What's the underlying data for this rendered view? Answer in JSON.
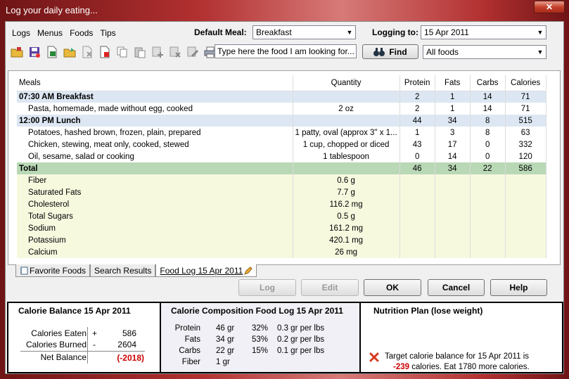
{
  "window": {
    "title": "Log your daily eating...",
    "close_label": "✕"
  },
  "menu": [
    "Logs",
    "Menus",
    "Foods",
    "Tips"
  ],
  "header": {
    "default_meal_label": "Default Meal:",
    "default_meal_value": "Breakfast",
    "logging_to_label": "Logging to:",
    "logging_to_value": "15 Apr 2011"
  },
  "toolbar": {
    "icons": [
      "open-folder-icon",
      "save-icon",
      "export-icon",
      "open-icon",
      "delete-icon",
      "pdf-icon",
      "copy-icon",
      "paste-icon",
      "add-icon",
      "clear-icon",
      "edit-icon",
      "print-icon"
    ],
    "search_value": "Type here the food I am looking for...",
    "find_label": "Find",
    "filter_value": "All foods"
  },
  "grid": {
    "headers": [
      "Meals",
      "Quantity",
      "Protein",
      "Fats",
      "Carbs",
      "Calories"
    ],
    "rows": [
      {
        "type": "meal",
        "name": "07:30 AM Breakfast",
        "qty": "",
        "protein": "2",
        "fats": "1",
        "carbs": "14",
        "calories": "71"
      },
      {
        "type": "item",
        "name": "Pasta, homemade, made without egg, cooked",
        "qty": "2 oz",
        "protein": "2",
        "fats": "1",
        "carbs": "14",
        "calories": "71"
      },
      {
        "type": "meal",
        "name": "12:00 PM Lunch",
        "qty": "",
        "protein": "44",
        "fats": "34",
        "carbs": "8",
        "calories": "515"
      },
      {
        "type": "item",
        "name": "Potatoes, hashed brown, frozen, plain, prepared",
        "qty": "1 patty, oval (approx 3\" x 1...",
        "protein": "1",
        "fats": "3",
        "carbs": "8",
        "calories": "63"
      },
      {
        "type": "item",
        "name": "Chicken, stewing, meat only, cooked, stewed",
        "qty": "1 cup, chopped or diced",
        "protein": "43",
        "fats": "17",
        "carbs": "0",
        "calories": "332"
      },
      {
        "type": "item",
        "name": "Oil, sesame, salad or cooking",
        "qty": "1 tablespoon",
        "protein": "0",
        "fats": "14",
        "carbs": "0",
        "calories": "120"
      },
      {
        "type": "total",
        "name": "Total",
        "qty": "",
        "protein": "46",
        "fats": "34",
        "carbs": "22",
        "calories": "586"
      },
      {
        "type": "nutr",
        "name": "Fiber",
        "qty": "0.6 g",
        "protein": "",
        "fats": "",
        "carbs": "",
        "calories": ""
      },
      {
        "type": "nutr",
        "name": "Saturated Fats",
        "qty": "7.7 g",
        "protein": "",
        "fats": "",
        "carbs": "",
        "calories": ""
      },
      {
        "type": "nutr",
        "name": "Cholesterol",
        "qty": "116.2 mg",
        "protein": "",
        "fats": "",
        "carbs": "",
        "calories": ""
      },
      {
        "type": "nutr",
        "name": "Total Sugars",
        "qty": "0.5 g",
        "protein": "",
        "fats": "",
        "carbs": "",
        "calories": ""
      },
      {
        "type": "nutr",
        "name": "Sodium",
        "qty": "161.2 mg",
        "protein": "",
        "fats": "",
        "carbs": "",
        "calories": ""
      },
      {
        "type": "nutr",
        "name": "Potassium",
        "qty": "420.1 mg",
        "protein": "",
        "fats": "",
        "carbs": "",
        "calories": ""
      },
      {
        "type": "nutr",
        "name": "Calcium",
        "qty": "26 mg",
        "protein": "",
        "fats": "",
        "carbs": "",
        "calories": ""
      }
    ]
  },
  "tabs": [
    "Favorite Foods",
    "Search Results",
    "Food Log 15 Apr 2011"
  ],
  "buttons": {
    "log": "Log",
    "edit": "Edit",
    "ok": "OK",
    "cancel": "Cancel",
    "help": "Help"
  },
  "balance": {
    "title": "Calorie Balance  15 Apr 2011",
    "eaten_label": "Calories Eaten",
    "eaten_sign": "+",
    "eaten_value": "586",
    "burned_label": "Calories Burned",
    "burned_sign": "-",
    "burned_value": "2604",
    "net_label": "Net Balance",
    "net_value": "(-2018)"
  },
  "composition": {
    "title": "Calorie Composition  Food Log 15 Apr 2011",
    "rows": [
      {
        "name": "Protein",
        "grams": "46 gr",
        "pct": "32%",
        "per_lbs": "0.3 gr per lbs"
      },
      {
        "name": "Fats",
        "grams": "34 gr",
        "pct": "53%",
        "per_lbs": "0.2 gr per lbs"
      },
      {
        "name": "Carbs",
        "grams": "22 gr",
        "pct": "15%",
        "per_lbs": "0.1 gr per lbs"
      },
      {
        "name": "Fiber",
        "grams": "1 gr",
        "pct": "",
        "per_lbs": ""
      }
    ]
  },
  "plan": {
    "title": "Nutrition Plan   (lose weight)",
    "line1": "Target calorie balance for 15 Apr 2011 is",
    "line2_value": "-239",
    "line2_rest": " calories. Eat 1780 more calories."
  },
  "colors": {
    "meal_row": "#dde7f3",
    "total_row": "#b9d8b6",
    "nutrient_row": "#f7f9df",
    "negative": "#cc0000"
  }
}
